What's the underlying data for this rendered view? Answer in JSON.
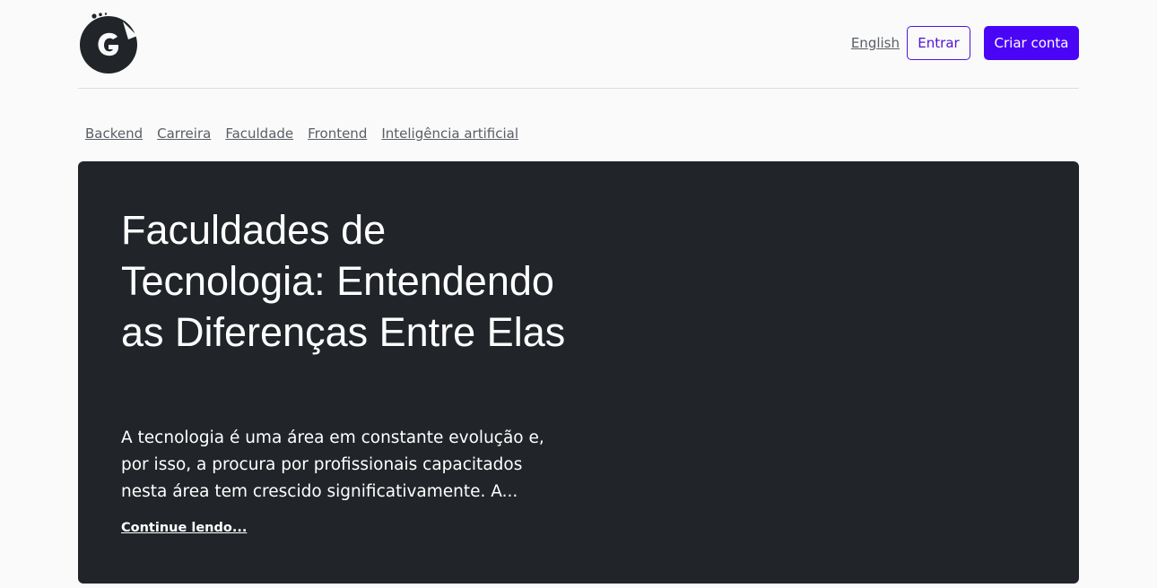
{
  "header": {
    "logo_icon": "g-logo-icon",
    "language_link": "English",
    "login_button": "Entrar",
    "signup_button": "Criar conta",
    "accent_color": "#4a05f7"
  },
  "categories": [
    {
      "label": "Backend"
    },
    {
      "label": "Carreira"
    },
    {
      "label": "Faculdade"
    },
    {
      "label": "Frontend"
    },
    {
      "label": "Inteligência artificial"
    }
  ],
  "featured": {
    "title": "Faculdades de Tecnologia: Entendendo as Diferenças Entre Elas",
    "excerpt": "A tecnologia é uma área em constante evolução e, por isso, a procura por profissionais capacitados nesta área tem crescido significativamente. A...",
    "read_more": "Continue lendo...",
    "background_color": "#212529"
  }
}
